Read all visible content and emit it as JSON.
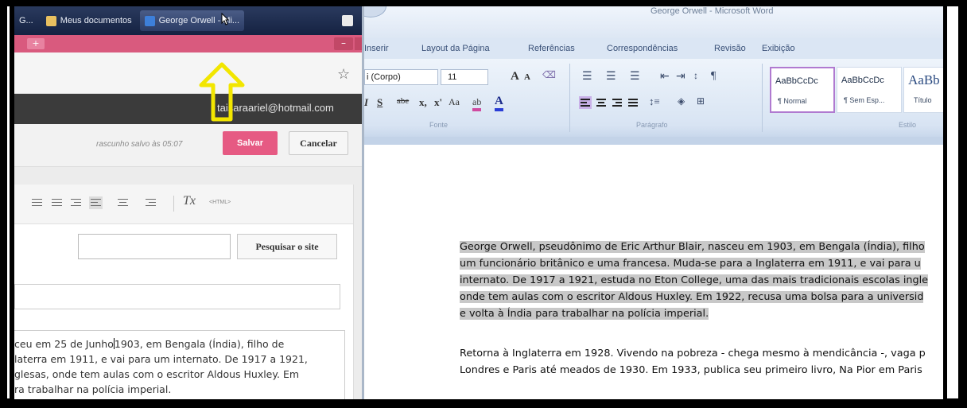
{
  "taskbar": {
    "items": [
      {
        "label": "G...",
        "icon": "browser-icon"
      },
      {
        "label": "Meus documentos",
        "icon": "folder-icon"
      },
      {
        "label": "George Orwell - Mi...",
        "icon": "word-icon"
      }
    ]
  },
  "browser": {
    "tab_new": "+",
    "window_min": "–",
    "bookmark_icon": "☆",
    "user_email": "taisaraariel@hotmail.com"
  },
  "editor": {
    "draft_status": "rascunho salvo às 05:07",
    "save_label": "Salvar",
    "cancel_label": "Cancelar",
    "toolbar": {
      "clear_format": "Tx",
      "html": "<HTML>"
    },
    "search_button": "Pesquisar o site",
    "search_value": "",
    "title_value": "",
    "body_lines": [
      "ceu em 25 de Junho",
      "1903, em Bengala (Índia), filho de",
      "laterra em 1911, e vai para um internato. De 1917 a 1921,",
      "glesas, onde tem aulas com o escritor Aldous Huxley. Em",
      "ra trabalhar na polícia imperial."
    ]
  },
  "word": {
    "title": "George Orwell - Microsoft Word",
    "menu": [
      "Inserir",
      "Layout da Página",
      "Referências",
      "Correspondências",
      "Revisão",
      "Exibição"
    ],
    "font_name": "i (Corpo)",
    "font_size": "11",
    "groups": {
      "font": "Fonte",
      "paragraph": "Parágrafo",
      "style": "Estilo"
    },
    "styles": [
      {
        "sample": "AaBbCcDc",
        "name": "¶ Normal"
      },
      {
        "sample": "AaBbCcDc",
        "name": "¶ Sem Esp..."
      },
      {
        "sample": "AaBb",
        "name": "Título"
      }
    ],
    "paragraph1": [
      "George Orwell, pseudônimo de Eric Arthur Blair, nasceu em 1903, em Bengala (Índia), filho",
      "um funcionário britânico e uma francesa. Muda-se para a Inglaterra em 1911, e vai para u",
      "internato. De 1917 a 1921, estuda no Eton College, uma das mais tradicionais escolas ingle",
      "onde tem aulas com o escritor Aldous Huxley. Em 1922, recusa uma bolsa para a universid",
      "e volta à Índia para trabalhar na polícia imperial."
    ],
    "paragraph2": [
      "Retorna à Inglaterra em 1928. Vivendo na pobreza - chega mesmo à mendicância -, vaga p",
      "Londres e Paris até meados de 1930. Em 1933, publica seu primeiro livro, Na Pior em Paris"
    ]
  },
  "colors": {
    "accent": "#e65a83",
    "tab_bar": "#d95a7e",
    "arrow": "#f2e600",
    "style_select": "#b07ad0"
  }
}
